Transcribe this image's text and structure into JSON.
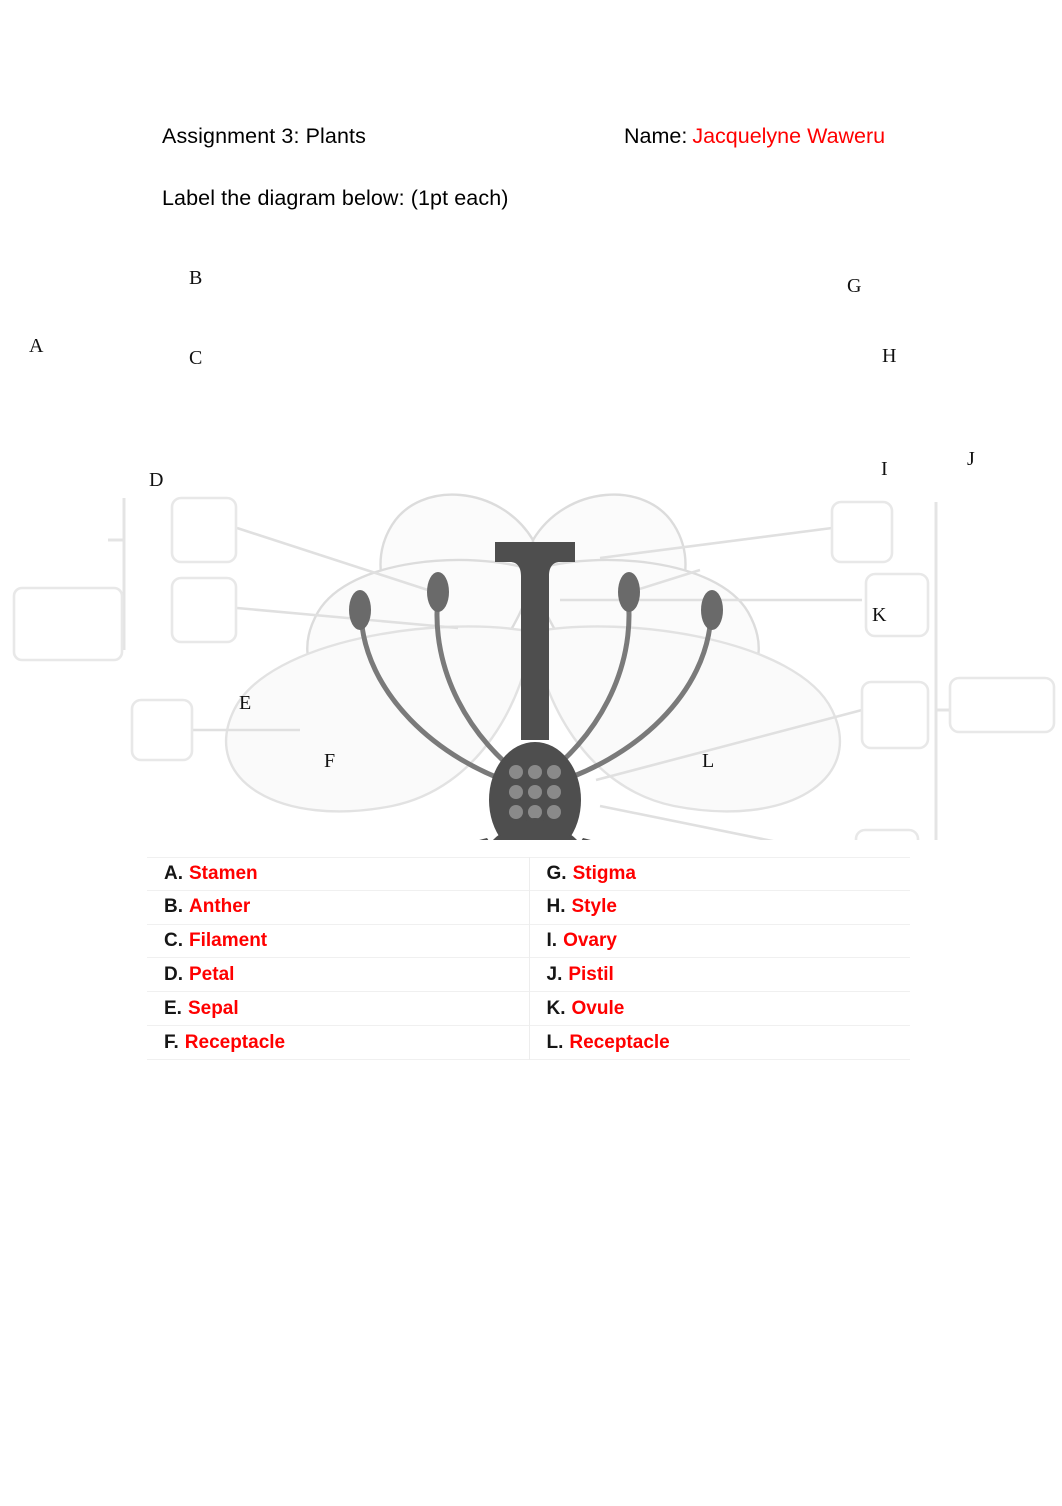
{
  "document": {
    "assignment_title": "Assignment 3: Plants",
    "name_label": "Name:",
    "student_name": "Jacquelyne Waweru",
    "instruction": "Label the diagram below: (1pt each)",
    "accent_color": "#ff0000",
    "text_color": "#000000"
  },
  "diagram": {
    "subject": "flower-anatomy-cross-section",
    "callouts": [
      {
        "letter": "A",
        "box": "wide"
      },
      {
        "letter": "B",
        "box": "small"
      },
      {
        "letter": "C",
        "box": "small"
      },
      {
        "letter": "D",
        "box": "small"
      },
      {
        "letter": "E",
        "box": "small"
      },
      {
        "letter": "F",
        "box": "small"
      },
      {
        "letter": "G",
        "box": "small"
      },
      {
        "letter": "H",
        "box": "small"
      },
      {
        "letter": "I",
        "box": "small"
      },
      {
        "letter": "J",
        "box": "wide"
      },
      {
        "letter": "K",
        "box": "small"
      },
      {
        "letter": "L",
        "box": "small"
      }
    ]
  },
  "answer_key": {
    "left_column": [
      {
        "letter": "A.",
        "term": "Stamen"
      },
      {
        "letter": "B.",
        "term": "Anther"
      },
      {
        "letter": "C.",
        "term": "Filament"
      },
      {
        "letter": "D.",
        "term": "Petal"
      },
      {
        "letter": "E.",
        "term": "Sepal"
      },
      {
        "letter": "F.",
        "term": "Receptacle"
      }
    ],
    "right_column": [
      {
        "letter": "G.",
        "term": "Stigma"
      },
      {
        "letter": "H.",
        "term": "Style"
      },
      {
        "letter": "I.",
        "term": "Ovary"
      },
      {
        "letter": "J.",
        "term": "Pistil"
      },
      {
        "letter": "K.",
        "term": "Ovule"
      },
      {
        "letter": "L.",
        "term": "Receptacle"
      }
    ]
  }
}
